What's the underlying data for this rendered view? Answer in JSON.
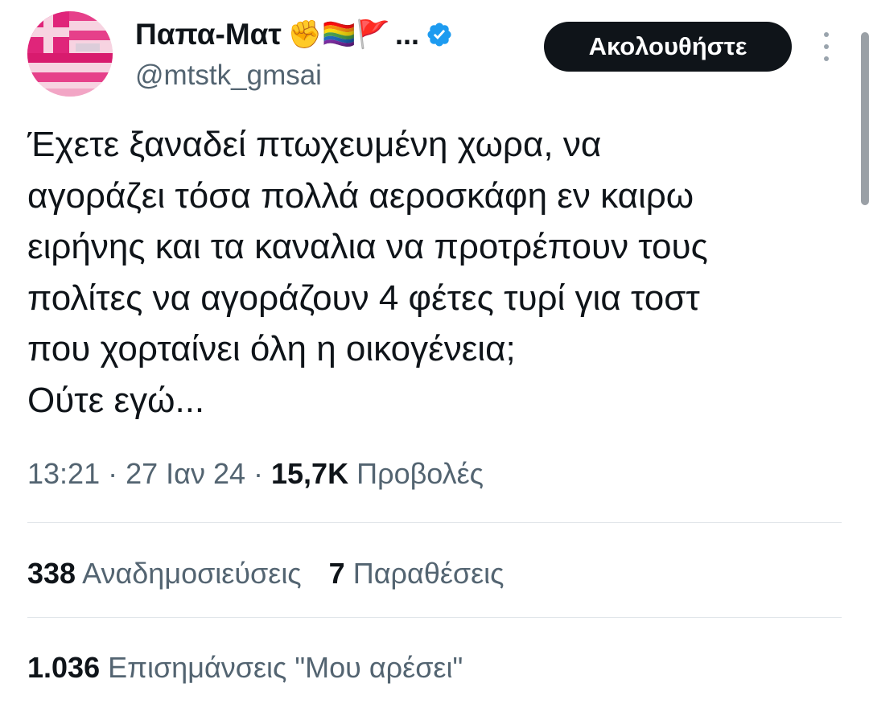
{
  "user": {
    "display_name": "Παπα-Ματ",
    "emojis": "✊🏳️‍🌈🚩",
    "truncation": "...",
    "handle": "@mtstk_gmsai",
    "verified_icon": "verified-badge-icon",
    "verified_color": "#1d9bf0"
  },
  "follow_button": {
    "label": "Ακολουθήστε"
  },
  "more_menu": {
    "icon": "more-vertical-icon"
  },
  "tweet": {
    "text": "Έχετε ξαναδεί πτωχευμένη χωρα, να\nαγοράζει τόσα πολλά αεροσκάφη εν καιρω\nειρήνης και τα καναλια να προτρέπουν τους\nπολίτες να αγοράζουν 4 φέτες τυρί για τοστ\nπου χορταίνει όλη η οικογένεια;\nΟύτε εγώ..."
  },
  "meta": {
    "time": "13:21",
    "separator": " · ",
    "date": "27 Ιαν 24",
    "views_count": "15,7K",
    "views_label": "Προβολές"
  },
  "stats": {
    "reposts_count": "338",
    "reposts_label": "Αναδημοσιεύσεις",
    "quotes_count": "7",
    "quotes_label": "Παραθέσεις",
    "likes_count": "1.036",
    "likes_label": "Επισημάνσεις \"Μου αρέσει\""
  },
  "colors": {
    "text_primary": "#0f1419",
    "text_secondary": "#536471",
    "button_bg": "#0f1419",
    "divider": "#e1e6ea"
  }
}
